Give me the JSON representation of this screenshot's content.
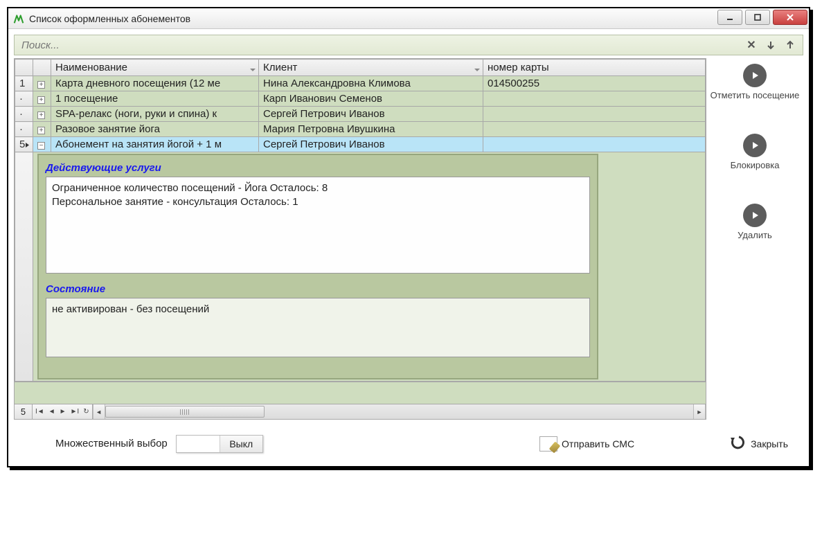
{
  "window": {
    "title": "Список оформленных абонементов"
  },
  "search": {
    "placeholder": "Поиск..."
  },
  "grid": {
    "headers": {
      "name": "Наименование",
      "client": "Клиент",
      "card": "номер карты"
    },
    "rows": [
      {
        "rownum": "1",
        "name": "Карта дневного посещения (12 ме",
        "client": "Нина Александровна Климова",
        "card": "014500255",
        "expander": "+"
      },
      {
        "rownum": "·",
        "name": "1 посещение",
        "client": "Карп Иванович Семенов",
        "card": "",
        "expander": "+"
      },
      {
        "rownum": "·",
        "name": "SPA-релакс (ноги, руки и спина) к",
        "client": "Сергей Петрович Иванов",
        "card": "",
        "expander": "+"
      },
      {
        "rownum": "·",
        "name": "Разовое занятие йога",
        "client": "Мария Петровна Ивушкина",
        "card": "",
        "expander": "+"
      },
      {
        "rownum": "5",
        "name": "Абонемент на занятия йогой + 1 м",
        "client": "Сергей Петрович Иванов",
        "card": "",
        "expander": "−"
      }
    ],
    "record_count": "5"
  },
  "detail": {
    "services_title": "Действующие услуги",
    "services": [
      "Ограниченное количество посещений - Йога Осталось: 8",
      "Персональное занятие - консультация Осталось: 1"
    ],
    "status_title": "Состояние",
    "status_text": "не активирован - без посещений"
  },
  "side": {
    "mark_visit": "Отметить посещение",
    "lock": "Блокировка",
    "delete": "Удалить"
  },
  "bottom": {
    "multi_label": "Множественный выбор",
    "toggle_off": "Выкл",
    "send_sms": "Отправить СМС",
    "close": "Закрыть"
  }
}
